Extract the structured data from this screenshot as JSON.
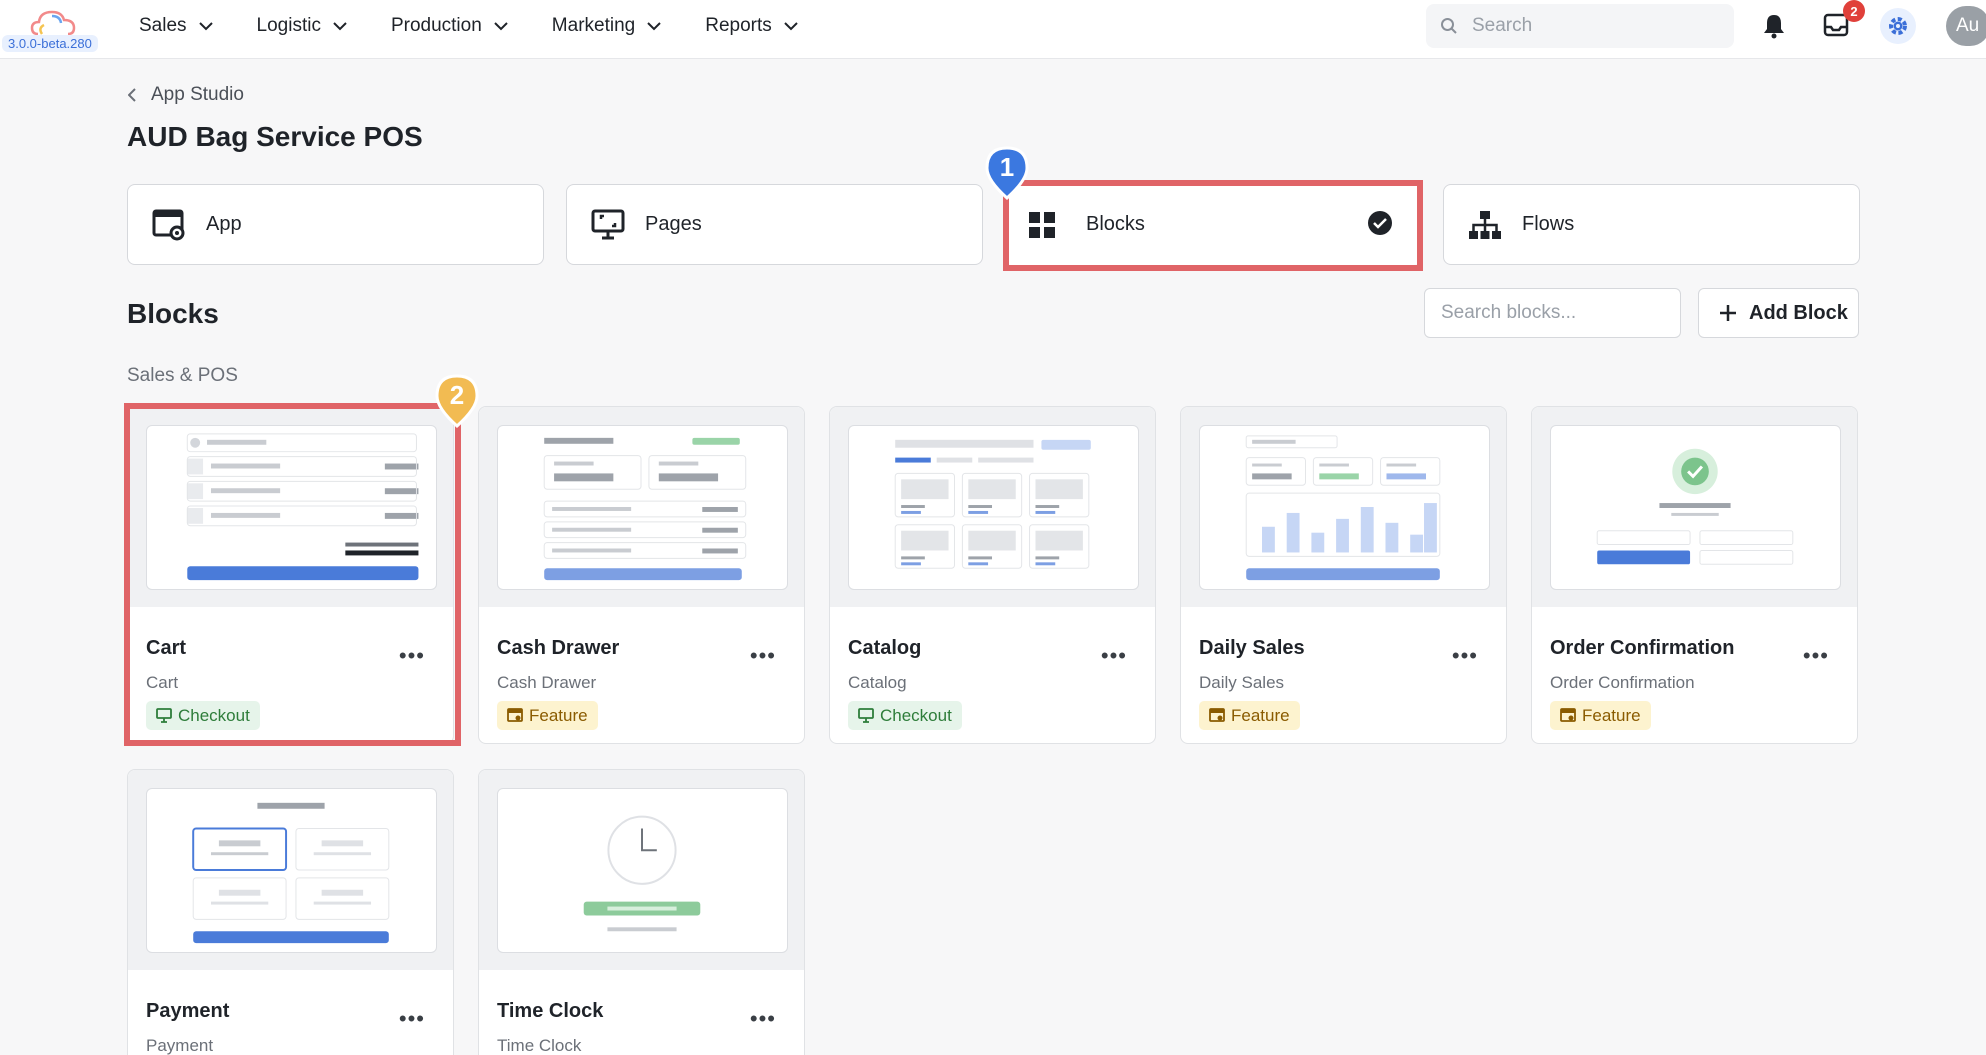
{
  "app": {
    "version": "3.0.0-beta.280"
  },
  "nav": {
    "items": [
      {
        "label": "Sales"
      },
      {
        "label": "Logistic"
      },
      {
        "label": "Production"
      },
      {
        "label": "Marketing"
      },
      {
        "label": "Reports"
      }
    ],
    "search_placeholder": "Search",
    "inbox_count": "2",
    "avatar_initials": "Au"
  },
  "header": {
    "breadcrumb": "App Studio",
    "title": "AUD Bag Service POS"
  },
  "segments": [
    {
      "label": "App",
      "icon": "app-settings-icon"
    },
    {
      "label": "Pages",
      "icon": "monitor-icon"
    },
    {
      "label": "Blocks",
      "icon": "grid-icon",
      "selected": true
    },
    {
      "label": "Flows",
      "icon": "sitemap-icon"
    }
  ],
  "blocks": {
    "title": "Blocks",
    "search_placeholder": "Search blocks...",
    "add_label": "Add Block",
    "section": "Sales & POS",
    "cards": [
      {
        "name": "Cart",
        "sub": "Cart",
        "tag": "Checkout",
        "tag_kind": "green"
      },
      {
        "name": "Cash Drawer",
        "sub": "Cash Drawer",
        "tag": "Feature",
        "tag_kind": "yellow"
      },
      {
        "name": "Catalog",
        "sub": "Catalog",
        "tag": "Checkout",
        "tag_kind": "green"
      },
      {
        "name": "Daily Sales",
        "sub": "Daily Sales",
        "tag": "Feature",
        "tag_kind": "yellow"
      },
      {
        "name": "Order Confirmation",
        "sub": "Order Confirmation",
        "tag": "Feature",
        "tag_kind": "yellow"
      },
      {
        "name": "Payment",
        "sub": "Payment"
      },
      {
        "name": "Time Clock",
        "sub": "Time Clock"
      }
    ]
  },
  "annotations": {
    "marker_1": "1",
    "marker_2": "2"
  },
  "colors": {
    "primary": "#4a7bd9",
    "highlight": "#e06467",
    "marker_blue": "#3b78e0",
    "marker_yellow": "#f2bb52"
  }
}
